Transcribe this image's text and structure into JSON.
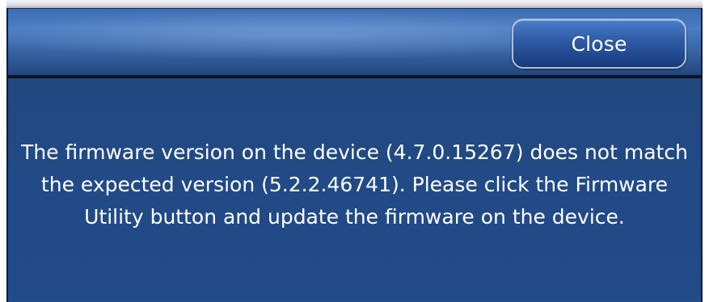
{
  "dialog": {
    "close_label": "Close",
    "message": "The firmware version on the device (4.7.0.15267) does not match the expected version (5.2.2.46741). Please click the Firmware Utility button and update the firmware on the device."
  },
  "colors": {
    "dialog_background": "#234c8a",
    "header_background": "#3a67a8",
    "button_background": "#2d5aa3",
    "text": "#ffffff"
  }
}
